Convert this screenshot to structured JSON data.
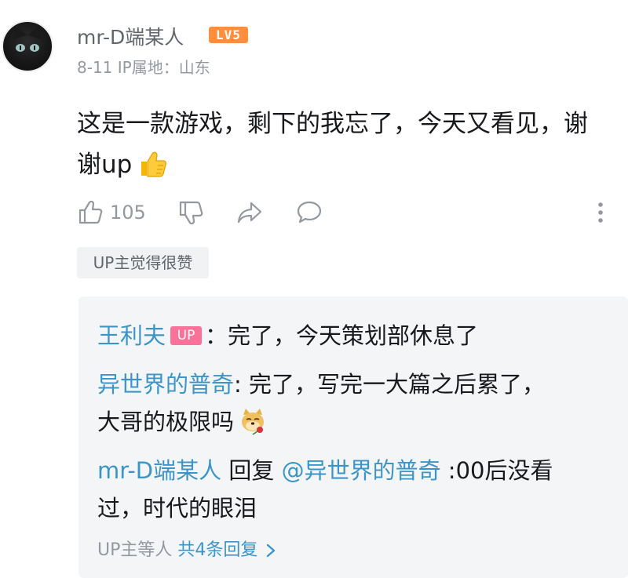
{
  "comment": {
    "username": "mr-D端某人",
    "level": "LV5",
    "date": "8-11",
    "ip_location": "IP属地：山东",
    "text_line1": "这是一款游戏，剩下的我忘了，今天又看见，谢",
    "text_line2": "谢up",
    "like_count": "105",
    "up_tag": "UP主觉得很赞"
  },
  "icons": {
    "like": "thumbs-up-icon",
    "dislike": "thumbs-down-icon",
    "share": "share-icon",
    "reply": "comment-icon",
    "more": "more-vertical-icon",
    "thumb_emoji": "thumbs-up-emoji",
    "doge_emoji": "doge-rose-emoji"
  },
  "replies": [
    {
      "name": "王利夫",
      "badge": "UP",
      "sep": "：",
      "text": "完了，今天策划部休息了"
    },
    {
      "name": "异世界的普奇",
      "sep": ":",
      "text_line1": " 完了，写完一大篇之后累了，",
      "text_line2": "大哥的极限吗"
    },
    {
      "name": "mr-D端某人",
      "reply_word": " 回复 ",
      "mention": "@异世界的普奇",
      "text_line1": " :00后没看",
      "text_line2": "过，时代的眼泪"
    }
  ],
  "more_replies": {
    "prefix": "UP主等人 ",
    "link": "共4条回复"
  },
  "colors": {
    "link_blue": "#3c95c9",
    "level_orange": "#ff8f3f",
    "up_pink": "#fb7299",
    "muted": "#9499a0"
  }
}
